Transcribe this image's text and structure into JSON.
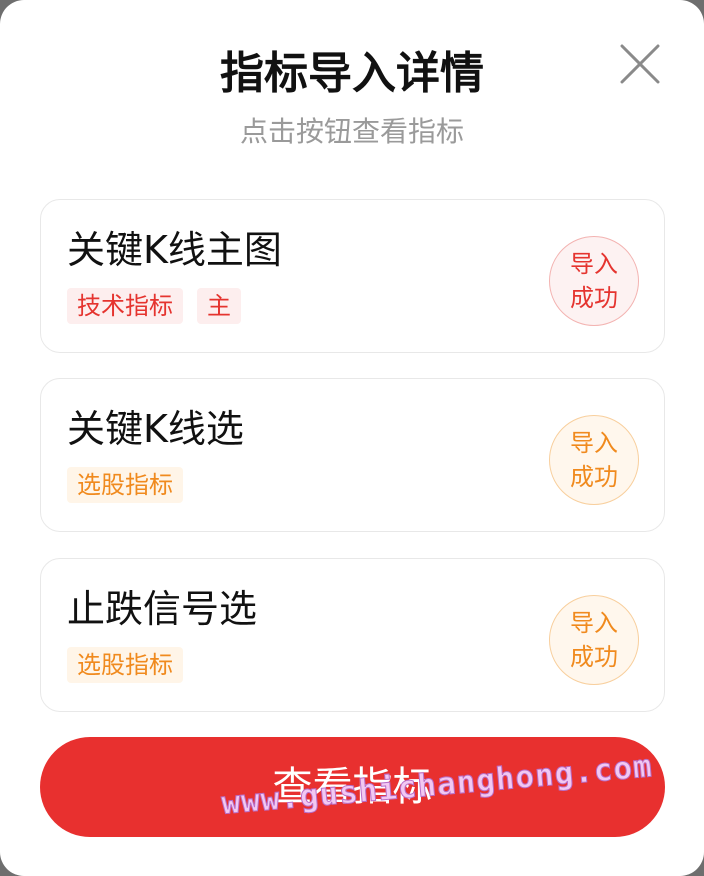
{
  "dialog": {
    "title": "指标导入详情",
    "subtitle": "点击按钮查看指标",
    "close_icon": "close-icon"
  },
  "indicators": [
    {
      "name": "关键K线主图",
      "tags": [
        "技术指标",
        "主"
      ],
      "tag_color": "#e5342f",
      "status_line1": "导入",
      "status_line2": "成功",
      "status_color": "#e5342f"
    },
    {
      "name": "关键K线选",
      "tags": [
        "选股指标"
      ],
      "tag_color": "#f08a1e",
      "status_line1": "导入",
      "status_line2": "成功",
      "status_color": "#f08a1e"
    },
    {
      "name": "止跌信号选",
      "tags": [
        "选股指标"
      ],
      "tag_color": "#f08a1e",
      "status_line1": "导入",
      "status_line2": "成功",
      "status_color": "#f08a1e"
    }
  ],
  "view_button_label": "查看指标",
  "watermark": "www.gushichanghong.com",
  "colors": {
    "primary": "#e8302f",
    "accent_orange": "#f08a1e"
  }
}
